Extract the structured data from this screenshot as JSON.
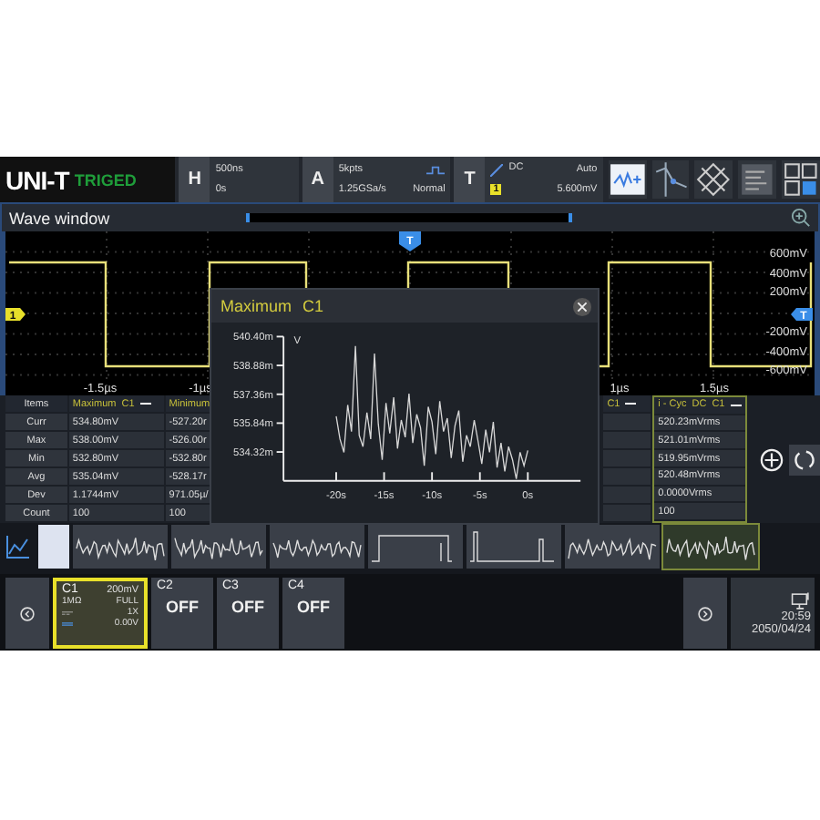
{
  "top_bar": {
    "logo": "UNI-T",
    "run_status": "TRIGED",
    "horizontal": {
      "label": "H",
      "timebase": "500ns",
      "delay": "0s"
    },
    "acquisition": {
      "label": "A",
      "memory_depth": "5kpts",
      "sample_rate": "1.25GSa/s",
      "mode": "Normal"
    },
    "trigger": {
      "label": "T",
      "coupling": "DC",
      "source": "1",
      "sweep": "Auto",
      "level": "5.600mV"
    }
  },
  "wave_window": {
    "title": "Wave window",
    "y_labels": [
      "600mV",
      "400mV",
      "200mV",
      "-200mV",
      "-400mV",
      "-600mV"
    ],
    "x_labels": [
      "-1.5µs",
      "-1µs",
      "1µs",
      "1.5µs"
    ],
    "trigger_marker": "T",
    "channel_marker": "1",
    "level_marker": "T"
  },
  "measurements": {
    "items_header": "Items",
    "row_labels": [
      "Curr",
      "Max",
      "Min",
      "Avg",
      "Dev",
      "Count"
    ],
    "columns": [
      {
        "kind": "full",
        "title": "Maximum",
        "channel": "C1",
        "selected": false,
        "values": [
          "534.80mV",
          "538.00mV",
          "532.80mV",
          "535.04mV",
          "1.1744mV",
          "100"
        ]
      },
      {
        "kind": "cut",
        "title": "Minimum",
        "selected": false,
        "values": [
          "-527.20r",
          "-526.00r",
          "-532.80r",
          "-528.17r",
          "971.05µ/",
          "100"
        ]
      },
      {
        "kind": "tail",
        "channel": "C1",
        "selected": false
      },
      {
        "kind": "full",
        "title": "i - Cyc",
        "coupling": "DC",
        "channel": "C1",
        "selected": true,
        "values": [
          "520.23mVrms",
          "521.01mVrms",
          "519.95mVrms",
          "520.48mVrms",
          "0.0000Vrms",
          "100"
        ]
      }
    ]
  },
  "thumbnails": [
    {
      "kind": "noise",
      "selected": false
    },
    {
      "kind": "noise",
      "selected": false
    },
    {
      "kind": "noise",
      "selected": false
    },
    {
      "kind": "pulse",
      "selected": false
    },
    {
      "kind": "pulse",
      "selected": false
    },
    {
      "kind": "noise",
      "selected": false
    },
    {
      "kind": "noise",
      "selected": true
    }
  ],
  "popup": {
    "title": "Maximum",
    "channel": "C1",
    "chart_data": {
      "type": "line",
      "ylabel": "V",
      "xlim": [
        -25.5,
        5.5
      ],
      "ylim": [
        532.8,
        540.4
      ],
      "xticks": [
        {
          "value": -20,
          "label": "-20s"
        },
        {
          "value": -15,
          "label": "-15s"
        },
        {
          "value": -10,
          "label": "-10s"
        },
        {
          "value": -5,
          "label": "-5s"
        },
        {
          "value": 0,
          "label": "0s"
        }
      ],
      "yticks": [
        {
          "value": 540.4,
          "label": "540.40m"
        },
        {
          "value": 538.88,
          "label": "538.88m"
        },
        {
          "value": 537.36,
          "label": "537.36m"
        },
        {
          "value": 535.84,
          "label": "535.84m"
        },
        {
          "value": 534.32,
          "label": "534.32m"
        }
      ],
      "x": [
        -20,
        -19.6,
        -19.2,
        -18.8,
        -18.4,
        -18,
        -17.6,
        -17.2,
        -16.8,
        -16.4,
        -16,
        -15.6,
        -15.2,
        -14.8,
        -14.4,
        -14,
        -13.6,
        -13.2,
        -12.8,
        -12.4,
        -12,
        -11.6,
        -11.2,
        -10.8,
        -10.4,
        -10,
        -9.6,
        -9.2,
        -8.8,
        -8.4,
        -8,
        -7.6,
        -7.2,
        -6.8,
        -6.4,
        -6,
        -5.6,
        -5.2,
        -4.8,
        -4.4,
        -4,
        -3.6,
        -3.2,
        -2.8,
        -2.4,
        -2,
        -1.6,
        -1.2,
        -0.8,
        -0.4,
        0
      ],
      "series": [
        {
          "color": "#d8d8d8",
          "values": [
            536.2,
            535.0,
            534.3,
            536.8,
            535.4,
            539.9,
            535.2,
            534.6,
            536.4,
            535.0,
            539.5,
            535.8,
            533.9,
            536.9,
            535.3,
            537.2,
            534.5,
            536.0,
            535.1,
            537.4,
            534.8,
            536.3,
            535.6,
            533.6,
            536.7,
            535.9,
            534.2,
            537.0,
            535.4,
            536.1,
            534.0,
            535.7,
            536.5,
            533.8,
            535.2,
            534.6,
            536.0,
            534.9,
            533.7,
            535.5,
            534.3,
            535.9,
            533.5,
            534.8,
            533.3,
            534.6,
            533.9,
            532.9,
            534.3,
            533.6,
            534.4
          ]
        }
      ]
    }
  },
  "channels": [
    {
      "kind": "detail",
      "label": "C1",
      "selected": true,
      "scale": "200mV",
      "impedance": "1MΩ",
      "bandwidth": "FULL",
      "probe": "1X",
      "offset": "0.00V"
    },
    {
      "kind": "off",
      "label": "C2",
      "status": "OFF",
      "selected": false
    },
    {
      "kind": "off",
      "label": "C3",
      "status": "OFF",
      "selected": false
    },
    {
      "kind": "off",
      "label": "C4",
      "status": "OFF",
      "selected": false
    }
  ],
  "clock": {
    "time": "20:59",
    "date": "2050/04/24"
  }
}
